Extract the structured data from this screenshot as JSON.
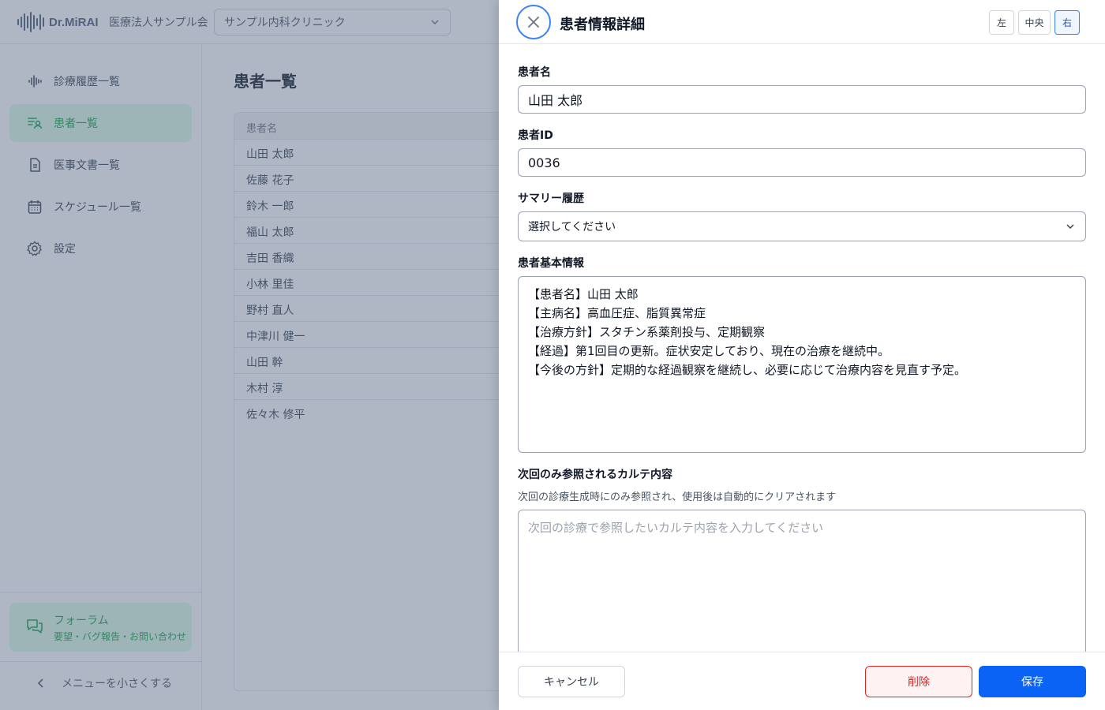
{
  "app": {
    "brand": "Dr.MiRAI",
    "org_name": "医療法人サンプル会",
    "clinic_select": "サンプル内科クリニック"
  },
  "sidebar": {
    "items": [
      {
        "label": "診療履歴一覧",
        "icon": "waveform-icon"
      },
      {
        "label": "患者一覧",
        "icon": "patient-list-icon",
        "active": true
      },
      {
        "label": "医事文書一覧",
        "icon": "document-icon"
      },
      {
        "label": "スケジュール一覧",
        "icon": "calendar-icon"
      },
      {
        "label": "設定",
        "icon": "gear-icon"
      }
    ],
    "forum": {
      "title": "フォーラム",
      "subtitle": "要望・バグ報告・お問い合わせ"
    },
    "collapse_label": "メニューを小さくする"
  },
  "main": {
    "title": "患者一覧",
    "table": {
      "header": "患者名",
      "rows": [
        "山田 太郎",
        "佐藤 花子",
        "鈴木 一郎",
        "福山 太郎",
        "吉田 香織",
        "小林 里佳",
        "野村 直人",
        "中津川 健一",
        "山田 幹",
        "木村 淳",
        "佐々木 修平"
      ]
    }
  },
  "drawer": {
    "title": "患者情報詳細",
    "position_buttons": [
      "左",
      "中央",
      "右"
    ],
    "active_position": "右",
    "fields": {
      "patient_name_label": "患者名",
      "patient_name_value": "山田 太郎",
      "patient_id_label": "患者ID",
      "patient_id_value": "0036",
      "summary_history_label": "サマリー履歴",
      "summary_history_selected": "選択してください",
      "basic_info_label": "患者基本情報",
      "basic_info_value": "【患者名】山田 太郎\n【主病名】高血圧症、脂質異常症\n【治療方針】スタチン系薬剤投与、定期観察\n【経過】第1回目の更新。症状安定しており、現在の治療を継続中。\n【今後の方針】定期的な経過観察を継続し、必要に応じて治療内容を見直す予定。",
      "next_chart_label": "次回のみ参照されるカルテ内容",
      "next_chart_helper": "次回の診療生成時にのみ参照され、使用後は自動的にクリアされます",
      "next_chart_placeholder": "次回の診療で参照したいカルテ内容を入力してください"
    },
    "footer": {
      "cancel": "キャンセル",
      "delete": "削除",
      "save": "保存"
    },
    "colors": {
      "primary": "#0b63f6",
      "danger": "#dc2626",
      "accent_green": "#16a34a"
    }
  }
}
